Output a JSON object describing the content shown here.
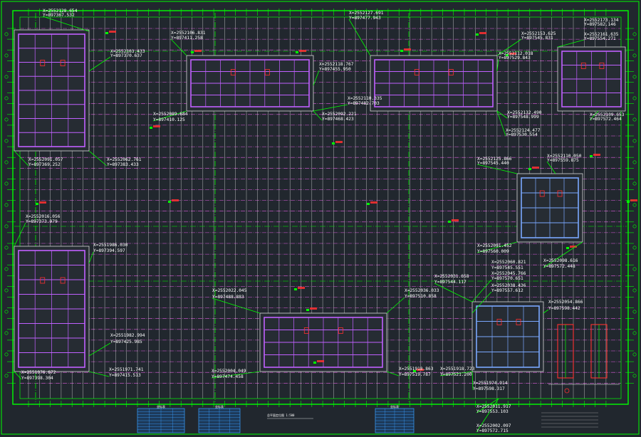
{
  "drawing": {
    "background": "#21272e",
    "colors": {
      "frame": "#00ff00",
      "axis": "#00e000",
      "grid_h": "#ff66ff",
      "grid_v": "#e8e8e8",
      "building": "#c060ff",
      "building_blue": "#7aa8ff",
      "text": "#ffffff",
      "table": "#3aa0ff",
      "red": "#ff3030"
    },
    "labels": [
      {
        "t": "X=2552128.654"
      },
      {
        "t": "Y=897367.532"
      },
      {
        "t": "X=2552106.831"
      },
      {
        "t": "Y=897411.258"
      },
      {
        "t": "X=2552103.433"
      },
      {
        "t": "Y=897370.637"
      },
      {
        "t": "X=2552127.691"
      },
      {
        "t": "Y=897477.943"
      },
      {
        "t": "X=2552118.767"
      },
      {
        "t": "Y=897455.950"
      },
      {
        "t": "X=2552153.625"
      },
      {
        "t": "Y=897545.831"
      },
      {
        "t": "X=2552112.018"
      },
      {
        "t": "Y=897529.843"
      },
      {
        "t": "X=2552173.134"
      },
      {
        "t": "Y=897582.146"
      },
      {
        "t": "X=2552161.635"
      },
      {
        "t": "Y=897554.271"
      },
      {
        "t": "X=2552110.335"
      },
      {
        "t": "Y=897482.703"
      },
      {
        "t": "X=2552092.221"
      },
      {
        "t": "Y=897468.423"
      },
      {
        "t": "X=2552089.684"
      },
      {
        "t": "Y=897410.125"
      },
      {
        "t": "X=2552132.490"
      },
      {
        "t": "Y=897548.999"
      },
      {
        "t": "X=2552124.477"
      },
      {
        "t": "Y=897530.554"
      },
      {
        "t": "X=2552109.653"
      },
      {
        "t": "Y=897572.464"
      },
      {
        "t": "X=2552091.057"
      },
      {
        "t": "Y=897369.252"
      },
      {
        "t": "X=2552062.761"
      },
      {
        "t": "Y=897383.433"
      },
      {
        "t": "X=2552125.866"
      },
      {
        "t": "Y=897545.440"
      },
      {
        "t": "X=2552110.050"
      },
      {
        "t": "Y=897559.875"
      },
      {
        "t": "X=2552016.056"
      },
      {
        "t": "Y=897373.979"
      },
      {
        "t": "X=2551986.030"
      },
      {
        "t": "Y=897394.597"
      },
      {
        "t": "X=2552091.452"
      },
      {
        "t": "Y=897560.009"
      },
      {
        "t": "X=2552098.616"
      },
      {
        "t": "Y=897572.448"
      },
      {
        "t": "X=2552060.821"
      },
      {
        "t": "Y=897545.551"
      },
      {
        "t": "X=2552045.766"
      },
      {
        "t": "Y=897570.651"
      },
      {
        "t": "X=2552038.436"
      },
      {
        "t": "Y=897557.612"
      },
      {
        "t": "X=2552022.045"
      },
      {
        "t": "Y=897488.883"
      },
      {
        "t": "X=2552036.033"
      },
      {
        "t": "Y=897510.858"
      },
      {
        "t": "X=2552031.658"
      },
      {
        "t": "Y=897544.117"
      },
      {
        "t": "X=2552054.866"
      },
      {
        "t": "Y=897598.442"
      },
      {
        "t": "X=2551982.994"
      },
      {
        "t": "Y=897425.985"
      },
      {
        "t": "X=2551971.741"
      },
      {
        "t": "Y=897415.513"
      },
      {
        "t": "X=2551976.672"
      },
      {
        "t": "Y=897398.304"
      },
      {
        "t": "X=2552004.049"
      },
      {
        "t": "Y=897474.458"
      },
      {
        "t": "X=2551918.863"
      },
      {
        "t": "Y=897519.787"
      },
      {
        "t": "X=2551918.723"
      },
      {
        "t": "Y=897521.200"
      },
      {
        "t": "X=2551974.914"
      },
      {
        "t": "Y=897598.317"
      },
      {
        "t": "X=2552011.917"
      },
      {
        "t": "Y=897553.103"
      },
      {
        "t": "X=2552002.097"
      },
      {
        "t": "Y=897572.715"
      }
    ],
    "tables": [
      {
        "title": "坐标表"
      },
      {
        "title": "坐标表"
      },
      {
        "title": "坐标表"
      }
    ],
    "notes": [
      {
        "t": "总平面定位图 1:500"
      }
    ]
  }
}
